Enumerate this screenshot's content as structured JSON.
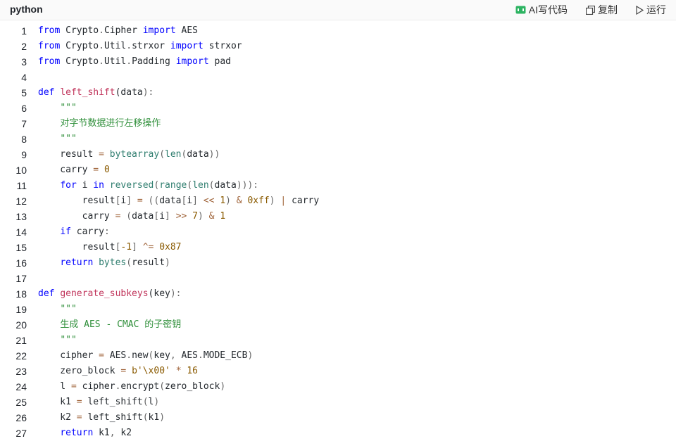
{
  "header": {
    "language": "python",
    "ai_label": "AI写代码",
    "copy_label": "复制",
    "run_label": "运行",
    "colors": {
      "ai_icon": "#2db462"
    }
  },
  "code": {
    "lines": [
      {
        "n": "1",
        "tokens": [
          {
            "t": "from",
            "c": "k"
          },
          {
            "t": " Crypto"
          },
          {
            "t": ".",
            "c": "p"
          },
          {
            "t": "Cipher "
          },
          {
            "t": "import",
            "c": "k"
          },
          {
            "t": " AES"
          }
        ]
      },
      {
        "n": "2",
        "tokens": [
          {
            "t": "from",
            "c": "k"
          },
          {
            "t": " Crypto"
          },
          {
            "t": ".",
            "c": "p"
          },
          {
            "t": "Util"
          },
          {
            "t": ".",
            "c": "p"
          },
          {
            "t": "strxor "
          },
          {
            "t": "import",
            "c": "k"
          },
          {
            "t": " strxor"
          }
        ]
      },
      {
        "n": "3",
        "tokens": [
          {
            "t": "from",
            "c": "k"
          },
          {
            "t": " Crypto"
          },
          {
            "t": ".",
            "c": "p"
          },
          {
            "t": "Util"
          },
          {
            "t": ".",
            "c": "p"
          },
          {
            "t": "Padding "
          },
          {
            "t": "import",
            "c": "k"
          },
          {
            "t": " pad"
          }
        ]
      },
      {
        "n": "4",
        "tokens": []
      },
      {
        "n": "5",
        "tokens": [
          {
            "t": "def",
            "c": "k"
          },
          {
            "t": " "
          },
          {
            "t": "left_shift",
            "c": "fn"
          },
          {
            "t": "("
          },
          {
            "t": "data"
          },
          {
            "t": "):",
            "c": "p"
          }
        ]
      },
      {
        "n": "6",
        "tokens": [
          {
            "t": "    "
          },
          {
            "t": "\"\"\"",
            "c": "s"
          }
        ]
      },
      {
        "n": "7",
        "tokens": [
          {
            "t": "    "
          },
          {
            "t": "对字节数据进行左移操作",
            "c": "s"
          }
        ]
      },
      {
        "n": "8",
        "tokens": [
          {
            "t": "    "
          },
          {
            "t": "\"\"\"",
            "c": "s"
          }
        ]
      },
      {
        "n": "9",
        "tokens": [
          {
            "t": "    result "
          },
          {
            "t": "=",
            "c": "op"
          },
          {
            "t": " "
          },
          {
            "t": "bytearray",
            "c": "bi"
          },
          {
            "t": "(",
            "c": "p"
          },
          {
            "t": "len",
            "c": "bi"
          },
          {
            "t": "(",
            "c": "p"
          },
          {
            "t": "data"
          },
          {
            "t": "))",
            "c": "p"
          }
        ]
      },
      {
        "n": "10",
        "tokens": [
          {
            "t": "    carry "
          },
          {
            "t": "=",
            "c": "op"
          },
          {
            "t": " "
          },
          {
            "t": "0",
            "c": "n"
          }
        ]
      },
      {
        "n": "11",
        "tokens": [
          {
            "t": "    "
          },
          {
            "t": "for",
            "c": "k"
          },
          {
            "t": " i "
          },
          {
            "t": "in",
            "c": "k"
          },
          {
            "t": " "
          },
          {
            "t": "reversed",
            "c": "bi"
          },
          {
            "t": "(",
            "c": "p"
          },
          {
            "t": "range",
            "c": "bi"
          },
          {
            "t": "(",
            "c": "p"
          },
          {
            "t": "len",
            "c": "bi"
          },
          {
            "t": "(",
            "c": "p"
          },
          {
            "t": "data"
          },
          {
            "t": "))):",
            "c": "p"
          }
        ]
      },
      {
        "n": "12",
        "tokens": [
          {
            "t": "        result"
          },
          {
            "t": "[",
            "c": "p"
          },
          {
            "t": "i"
          },
          {
            "t": "]",
            "c": "p"
          },
          {
            "t": " "
          },
          {
            "t": "=",
            "c": "op"
          },
          {
            "t": " "
          },
          {
            "t": "((",
            "c": "p"
          },
          {
            "t": "data"
          },
          {
            "t": "[",
            "c": "p"
          },
          {
            "t": "i"
          },
          {
            "t": "]",
            "c": "p"
          },
          {
            "t": " "
          },
          {
            "t": "<<",
            "c": "op"
          },
          {
            "t": " "
          },
          {
            "t": "1",
            "c": "n"
          },
          {
            "t": ")",
            "c": "p"
          },
          {
            "t": " "
          },
          {
            "t": "&",
            "c": "op"
          },
          {
            "t": " "
          },
          {
            "t": "0xff",
            "c": "n"
          },
          {
            "t": ")",
            "c": "p"
          },
          {
            "t": " "
          },
          {
            "t": "|",
            "c": "op"
          },
          {
            "t": " carry"
          }
        ]
      },
      {
        "n": "13",
        "tokens": [
          {
            "t": "        carry "
          },
          {
            "t": "=",
            "c": "op"
          },
          {
            "t": " "
          },
          {
            "t": "(",
            "c": "p"
          },
          {
            "t": "data"
          },
          {
            "t": "[",
            "c": "p"
          },
          {
            "t": "i"
          },
          {
            "t": "]",
            "c": "p"
          },
          {
            "t": " "
          },
          {
            "t": ">>",
            "c": "op"
          },
          {
            "t": " "
          },
          {
            "t": "7",
            "c": "n"
          },
          {
            "t": ")",
            "c": "p"
          },
          {
            "t": " "
          },
          {
            "t": "&",
            "c": "op"
          },
          {
            "t": " "
          },
          {
            "t": "1",
            "c": "n"
          }
        ]
      },
      {
        "n": "14",
        "tokens": [
          {
            "t": "    "
          },
          {
            "t": "if",
            "c": "k"
          },
          {
            "t": " carry"
          },
          {
            "t": ":",
            "c": "p"
          }
        ]
      },
      {
        "n": "15",
        "tokens": [
          {
            "t": "        result"
          },
          {
            "t": "[",
            "c": "p"
          },
          {
            "t": "-1",
            "c": "n"
          },
          {
            "t": "]",
            "c": "p"
          },
          {
            "t": " "
          },
          {
            "t": "^=",
            "c": "op"
          },
          {
            "t": " "
          },
          {
            "t": "0x87",
            "c": "n"
          }
        ]
      },
      {
        "n": "16",
        "tokens": [
          {
            "t": "    "
          },
          {
            "t": "return",
            "c": "k"
          },
          {
            "t": " "
          },
          {
            "t": "bytes",
            "c": "bi"
          },
          {
            "t": "(",
            "c": "p"
          },
          {
            "t": "result"
          },
          {
            "t": ")",
            "c": "p"
          }
        ]
      },
      {
        "n": "17",
        "tokens": []
      },
      {
        "n": "18",
        "tokens": [
          {
            "t": "def",
            "c": "k"
          },
          {
            "t": " "
          },
          {
            "t": "generate_subkeys",
            "c": "fn"
          },
          {
            "t": "("
          },
          {
            "t": "key"
          },
          {
            "t": "):",
            "c": "p"
          }
        ]
      },
      {
        "n": "19",
        "tokens": [
          {
            "t": "    "
          },
          {
            "t": "\"\"\"",
            "c": "s"
          }
        ]
      },
      {
        "n": "20",
        "tokens": [
          {
            "t": "    "
          },
          {
            "t": "生成 AES - CMAC 的子密钥",
            "c": "s"
          }
        ]
      },
      {
        "n": "21",
        "tokens": [
          {
            "t": "    "
          },
          {
            "t": "\"\"\"",
            "c": "s"
          }
        ]
      },
      {
        "n": "22",
        "tokens": [
          {
            "t": "    cipher "
          },
          {
            "t": "=",
            "c": "op"
          },
          {
            "t": " AES"
          },
          {
            "t": ".",
            "c": "p"
          },
          {
            "t": "new"
          },
          {
            "t": "(",
            "c": "p"
          },
          {
            "t": "key"
          },
          {
            "t": ",",
            "c": "p"
          },
          {
            "t": " AES"
          },
          {
            "t": ".",
            "c": "p"
          },
          {
            "t": "MODE_ECB"
          },
          {
            "t": ")",
            "c": "p"
          }
        ]
      },
      {
        "n": "23",
        "tokens": [
          {
            "t": "    zero_block "
          },
          {
            "t": "=",
            "c": "op"
          },
          {
            "t": " "
          },
          {
            "t": "b'\\x00'",
            "c": "n"
          },
          {
            "t": " "
          },
          {
            "t": "*",
            "c": "op"
          },
          {
            "t": " "
          },
          {
            "t": "16",
            "c": "n"
          }
        ]
      },
      {
        "n": "24",
        "tokens": [
          {
            "t": "    l "
          },
          {
            "t": "=",
            "c": "op"
          },
          {
            "t": " cipher"
          },
          {
            "t": ".",
            "c": "p"
          },
          {
            "t": "encrypt"
          },
          {
            "t": "(",
            "c": "p"
          },
          {
            "t": "zero_block"
          },
          {
            "t": ")",
            "c": "p"
          }
        ]
      },
      {
        "n": "25",
        "tokens": [
          {
            "t": "    k1 "
          },
          {
            "t": "=",
            "c": "op"
          },
          {
            "t": " left_shift"
          },
          {
            "t": "(",
            "c": "p"
          },
          {
            "t": "l"
          },
          {
            "t": ")",
            "c": "p"
          }
        ]
      },
      {
        "n": "26",
        "tokens": [
          {
            "t": "    k2 "
          },
          {
            "t": "=",
            "c": "op"
          },
          {
            "t": " left_shift"
          },
          {
            "t": "(",
            "c": "p"
          },
          {
            "t": "k1"
          },
          {
            "t": ")",
            "c": "p"
          }
        ]
      },
      {
        "n": "27",
        "tokens": [
          {
            "t": "    "
          },
          {
            "t": "return",
            "c": "k"
          },
          {
            "t": " k1"
          },
          {
            "t": ",",
            "c": "p"
          },
          {
            "t": " k2"
          }
        ]
      }
    ]
  }
}
